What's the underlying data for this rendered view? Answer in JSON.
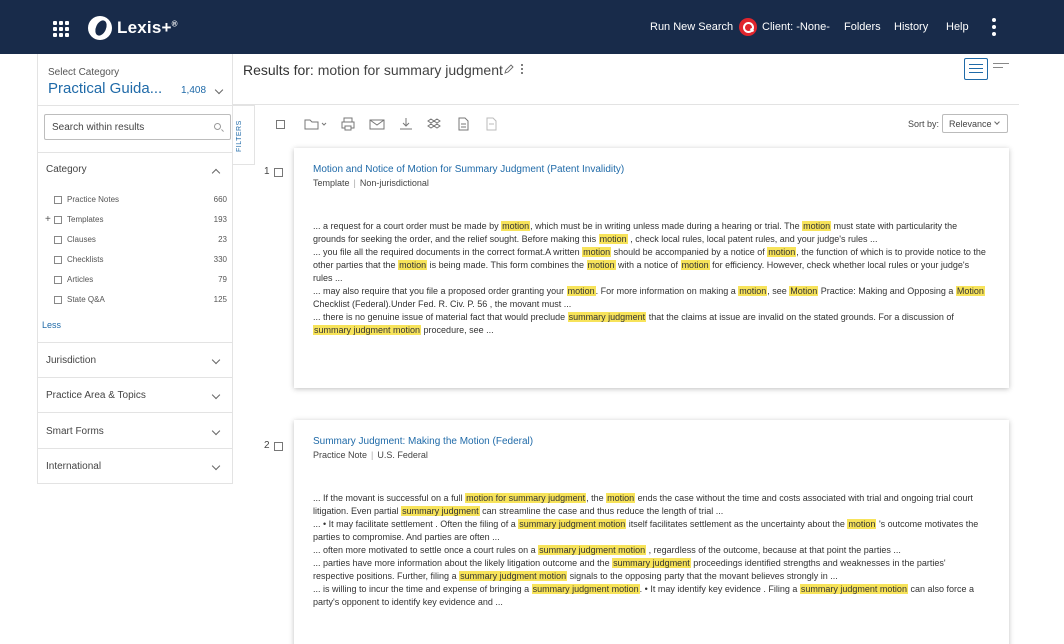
{
  "header": {
    "brand": "Lexis+",
    "brand_tm": "®",
    "run_new_search": "Run New Search",
    "client": "Client: -None-",
    "folders": "Folders",
    "history": "History",
    "help": "Help"
  },
  "sidebar": {
    "select_category_label": "Select Category",
    "category_value": "Practical Guida...",
    "category_count": "1,408",
    "search_placeholder": "Search within results",
    "category_heading": "Category",
    "category_items": [
      {
        "label": "Practice Notes",
        "count": "660"
      },
      {
        "label": "Templates",
        "count": "193"
      },
      {
        "label": "Clauses",
        "count": "23"
      },
      {
        "label": "Checklists",
        "count": "330"
      },
      {
        "label": "Articles",
        "count": "79"
      },
      {
        "label": "State Q&A",
        "count": "125"
      }
    ],
    "less_label": "Less",
    "sections": [
      "Jurisdiction",
      "Practice Area & Topics",
      "Smart Forms",
      "International"
    ]
  },
  "results": {
    "prefix": "Results for: ",
    "query": "motion for summary judgment",
    "filters_label": "FILTERS",
    "sort_label": "Sort by:",
    "sort_value": "Relevance",
    "items": [
      {
        "number": "1",
        "title": "Motion and Notice of Motion for Summary Judgment (Patent Invalidity)",
        "type": "Template",
        "jurisdiction": "Non-jurisdictional"
      },
      {
        "number": "2",
        "title": "Summary Judgment: Making the Motion (Federal)",
        "type": "Practice Note",
        "jurisdiction": "U.S. Federal"
      }
    ]
  }
}
